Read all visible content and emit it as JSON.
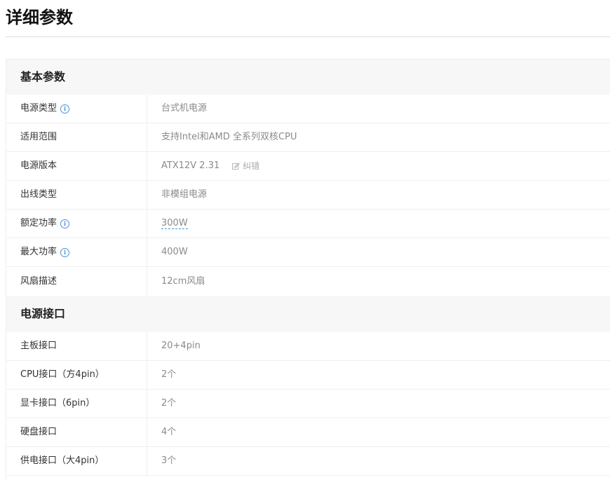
{
  "page_title": "详细参数",
  "sections": [
    {
      "title": "基本参数",
      "rows": [
        {
          "label": "电源类型",
          "value": "台式机电源",
          "info": true
        },
        {
          "label": "适用范围",
          "value": "支持Intel和AMD 全系列双核CPU"
        },
        {
          "label": "电源版本",
          "value": "ATX12V 2.31",
          "correction": "纠错"
        },
        {
          "label": "出线类型",
          "value": "非模组电源"
        },
        {
          "label": "额定功率",
          "value": "300W",
          "info": true,
          "linked": true
        },
        {
          "label": "最大功率",
          "value": "400W",
          "info": true
        },
        {
          "label": "风扇描述",
          "value": "12cm风扇"
        }
      ]
    },
    {
      "title": "电源接口",
      "rows": [
        {
          "label": "主板接口",
          "value": "20+4pin"
        },
        {
          "label": "CPU接口（方4pin）",
          "value": "2个"
        },
        {
          "label": "显卡接口（6pin）",
          "value": "2个"
        },
        {
          "label": "硬盘接口",
          "value": "4个"
        },
        {
          "label": "供电接口（大4pin）",
          "value": "3个"
        }
      ]
    }
  ],
  "icons": {
    "info": "info-icon",
    "edit": "edit-icon"
  },
  "colors": {
    "accent": "#4a90d9",
    "header_bg": "#f7f7f7",
    "value_text": "#8a8a8a"
  }
}
